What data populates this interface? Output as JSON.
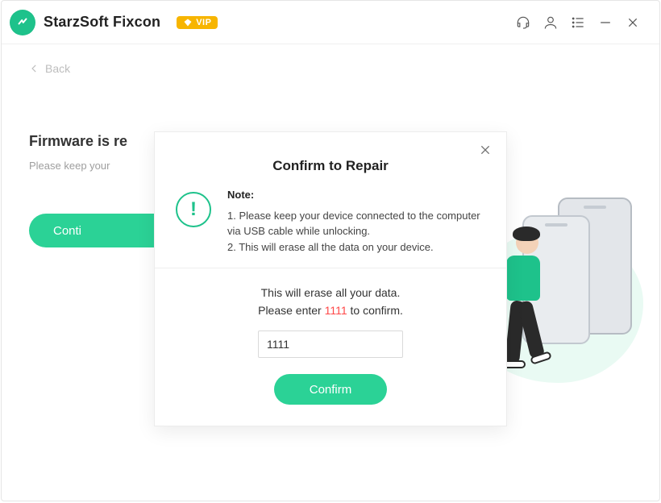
{
  "header": {
    "app_title": "StarzSoft Fixcon",
    "vip_label": "VIP"
  },
  "back_label": "Back",
  "background": {
    "title_partial": "Firmware is re",
    "subtitle_partial": "Please keep your",
    "continue_label": "Conti"
  },
  "modal": {
    "title": "Confirm to Repair",
    "note_heading": "Note:",
    "note_line1": "1. Please keep your device connected to the computer via USB cable while unlocking.",
    "note_line2": "2. This will erase all the data on your device.",
    "erase_line1": "This will erase all your data.",
    "erase_line2a": "Please enter ",
    "confirm_code": "1111",
    "erase_line2b": " to confirm.",
    "input_value": "1111",
    "confirm_button": "Confirm"
  }
}
